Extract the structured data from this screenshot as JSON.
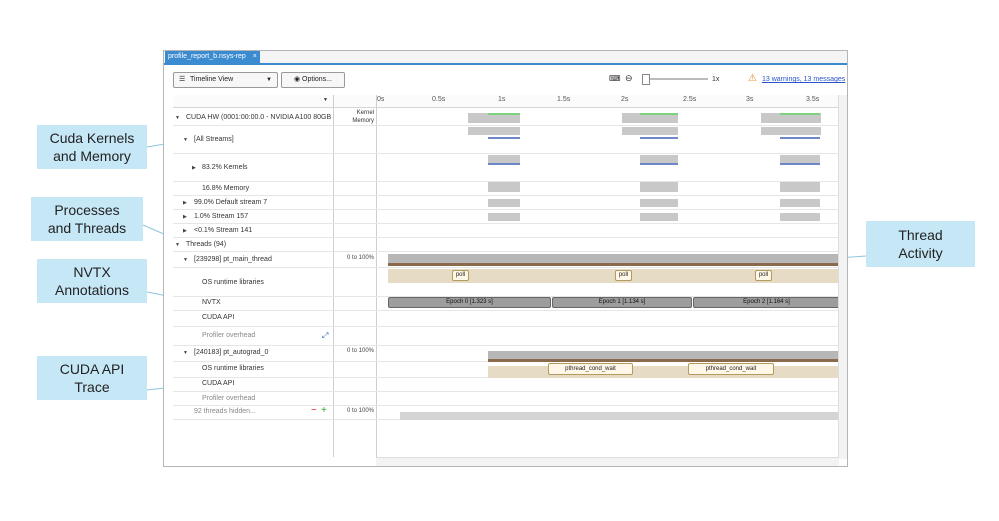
{
  "window": {
    "tab_label": "profile_report_b.nsys-rep",
    "tab_close": "×"
  },
  "toolbar": {
    "view_select": "Timeline View",
    "options_label": "Options...",
    "zoom_label": "1x",
    "warnings_link": "13 warnings, 13 messages"
  },
  "header": {
    "kernel_memory_label": "Kernel Memory",
    "ticks": [
      "0s",
      "0.5s",
      "1s",
      "1.5s",
      "2s",
      "2.5s",
      "3s",
      "3.5s"
    ]
  },
  "rows": {
    "cuda_hw": "CUDA HW (0001:00:00.0 - NVIDIA A100 80GB",
    "all_streams": "[All Streams]",
    "kernels": "83.2% Kernels",
    "memory": "16.8% Memory",
    "default_stream": "99.0% Default stream 7",
    "stream157": "1.0% Stream 157",
    "stream141": "<0.1% Stream 141",
    "threads": "Threads (94)",
    "main_thread": "[239298] pt_main_thread",
    "os_runtime": "OS runtime libraries",
    "nvtx": "NVTX",
    "cuda_api": "CUDA API",
    "profiler_overhead": "Profiler overhead",
    "autograd_thread": "[240183] pt_autograd_0",
    "os_runtime2": "OS runtime libraries",
    "cuda_api2": "CUDA API",
    "profiler_overhead2": "Profiler overhead",
    "hidden_threads": "92 threads hidden...",
    "hidden_minus": "−",
    "hidden_plus": "+",
    "range1": "0 to 100%",
    "range2": "0 to 100%",
    "range3": "0 to 100%"
  },
  "timeline": {
    "poll": "poll",
    "epochs": [
      "Epoch 0 [1.323 s]",
      "Epoch 1 [1.134 s]",
      "Epoch 2 [1.164 s]"
    ],
    "pthread": "pthread_cond_wait"
  },
  "callouts": {
    "kernels_memory": "Cuda Kernels and Memory",
    "processes_threads": "Processes and Threads",
    "nvtx": "NVTX Annotations",
    "cuda_api": "CUDA API Trace",
    "thread_activity": "Thread Activity"
  },
  "colors": {
    "accent": "#3b8bd0",
    "callout_bg": "#c6e7f6",
    "kernel_blue": "#6e87c7",
    "memory_green": "#7ed17e",
    "activity_gray": "#a4a4a4",
    "os_tan": "#d8cdb5",
    "thread_brown": "#8a6a4a"
  },
  "icons": [
    "hamburger-icon",
    "eye-icon",
    "keyboard-icon",
    "zoom-out-icon",
    "warning-icon",
    "dropdown-icon"
  ]
}
